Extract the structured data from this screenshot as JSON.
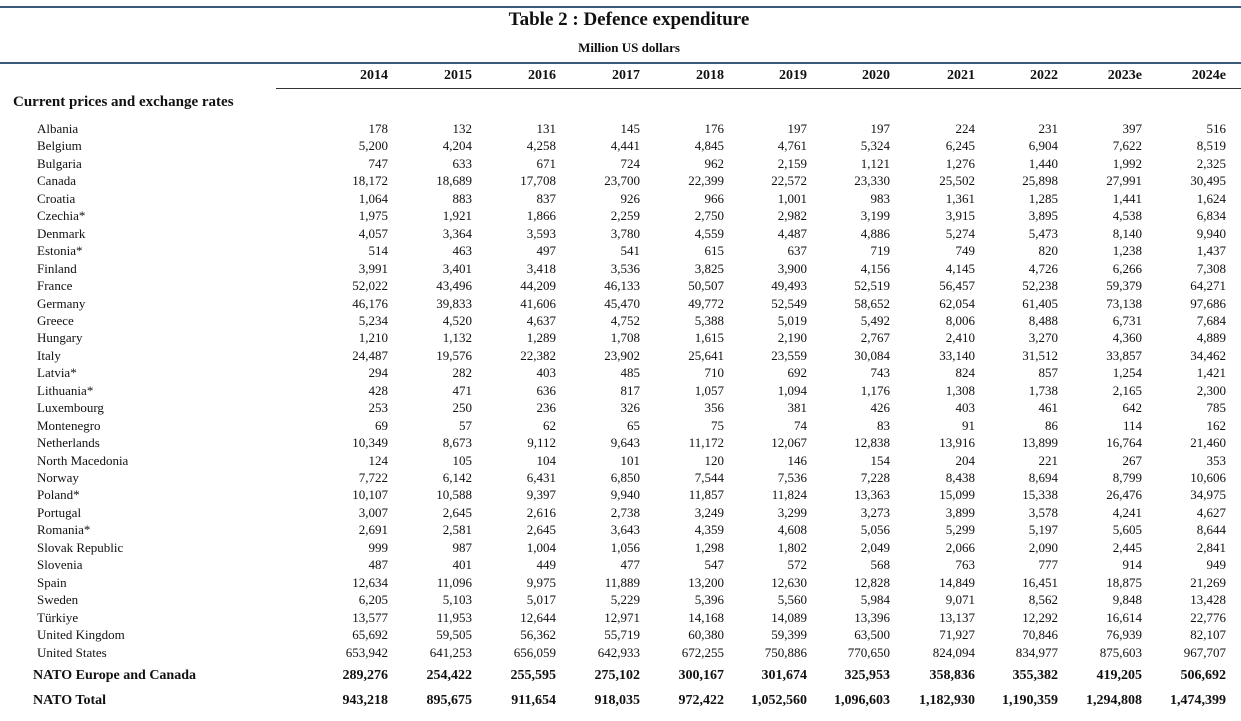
{
  "title": "Table 2 : Defence expenditure",
  "subtitle": "Million US dollars",
  "years": [
    "2014",
    "2015",
    "2016",
    "2017",
    "2018",
    "2019",
    "2020",
    "2021",
    "2022",
    "2023e",
    "2024e"
  ],
  "section_label": "Current prices and exchange rates",
  "rows": [
    {
      "name": "Albania",
      "values": [
        "178",
        "132",
        "131",
        "145",
        "176",
        "197",
        "197",
        "224",
        "231",
        "397",
        "516"
      ]
    },
    {
      "name": "Belgium",
      "values": [
        "5,200",
        "4,204",
        "4,258",
        "4,441",
        "4,845",
        "4,761",
        "5,324",
        "6,245",
        "6,904",
        "7,622",
        "8,519"
      ]
    },
    {
      "name": "Bulgaria",
      "values": [
        "747",
        "633",
        "671",
        "724",
        "962",
        "2,159",
        "1,121",
        "1,276",
        "1,440",
        "1,992",
        "2,325"
      ]
    },
    {
      "name": "Canada",
      "values": [
        "18,172",
        "18,689",
        "17,708",
        "23,700",
        "22,399",
        "22,572",
        "23,330",
        "25,502",
        "25,898",
        "27,991",
        "30,495"
      ]
    },
    {
      "name": "Croatia",
      "values": [
        "1,064",
        "883",
        "837",
        "926",
        "966",
        "1,001",
        "983",
        "1,361",
        "1,285",
        "1,441",
        "1,624"
      ]
    },
    {
      "name": "Czechia*",
      "values": [
        "1,975",
        "1,921",
        "1,866",
        "2,259",
        "2,750",
        "2,982",
        "3,199",
        "3,915",
        "3,895",
        "4,538",
        "6,834"
      ]
    },
    {
      "name": "Denmark",
      "values": [
        "4,057",
        "3,364",
        "3,593",
        "3,780",
        "4,559",
        "4,487",
        "4,886",
        "5,274",
        "5,473",
        "8,140",
        "9,940"
      ]
    },
    {
      "name": "Estonia*",
      "values": [
        "514",
        "463",
        "497",
        "541",
        "615",
        "637",
        "719",
        "749",
        "820",
        "1,238",
        "1,437"
      ]
    },
    {
      "name": "Finland",
      "values": [
        "3,991",
        "3,401",
        "3,418",
        "3,536",
        "3,825",
        "3,900",
        "4,156",
        "4,145",
        "4,726",
        "6,266",
        "7,308"
      ]
    },
    {
      "name": "France",
      "values": [
        "52,022",
        "43,496",
        "44,209",
        "46,133",
        "50,507",
        "49,493",
        "52,519",
        "56,457",
        "52,238",
        "59,379",
        "64,271"
      ]
    },
    {
      "name": "Germany",
      "values": [
        "46,176",
        "39,833",
        "41,606",
        "45,470",
        "49,772",
        "52,549",
        "58,652",
        "62,054",
        "61,405",
        "73,138",
        "97,686"
      ]
    },
    {
      "name": "Greece",
      "values": [
        "5,234",
        "4,520",
        "4,637",
        "4,752",
        "5,388",
        "5,019",
        "5,492",
        "8,006",
        "8,488",
        "6,731",
        "7,684"
      ]
    },
    {
      "name": "Hungary",
      "values": [
        "1,210",
        "1,132",
        "1,289",
        "1,708",
        "1,615",
        "2,190",
        "2,767",
        "2,410",
        "3,270",
        "4,360",
        "4,889"
      ]
    },
    {
      "name": "Italy",
      "values": [
        "24,487",
        "19,576",
        "22,382",
        "23,902",
        "25,641",
        "23,559",
        "30,084",
        "33,140",
        "31,512",
        "33,857",
        "34,462"
      ]
    },
    {
      "name": "Latvia*",
      "values": [
        "294",
        "282",
        "403",
        "485",
        "710",
        "692",
        "743",
        "824",
        "857",
        "1,254",
        "1,421"
      ]
    },
    {
      "name": "Lithuania*",
      "values": [
        "428",
        "471",
        "636",
        "817",
        "1,057",
        "1,094",
        "1,176",
        "1,308",
        "1,738",
        "2,165",
        "2,300"
      ]
    },
    {
      "name": "Luxembourg",
      "values": [
        "253",
        "250",
        "236",
        "326",
        "356",
        "381",
        "426",
        "403",
        "461",
        "642",
        "785"
      ]
    },
    {
      "name": "Montenegro",
      "values": [
        "69",
        "57",
        "62",
        "65",
        "75",
        "74",
        "83",
        "91",
        "86",
        "114",
        "162"
      ]
    },
    {
      "name": "Netherlands",
      "values": [
        "10,349",
        "8,673",
        "9,112",
        "9,643",
        "11,172",
        "12,067",
        "12,838",
        "13,916",
        "13,899",
        "16,764",
        "21,460"
      ]
    },
    {
      "name": "North Macedonia",
      "values": [
        "124",
        "105",
        "104",
        "101",
        "120",
        "146",
        "154",
        "204",
        "221",
        "267",
        "353"
      ]
    },
    {
      "name": "Norway",
      "values": [
        "7,722",
        "6,142",
        "6,431",
        "6,850",
        "7,544",
        "7,536",
        "7,228",
        "8,438",
        "8,694",
        "8,799",
        "10,606"
      ]
    },
    {
      "name": "Poland*",
      "values": [
        "10,107",
        "10,588",
        "9,397",
        "9,940",
        "11,857",
        "11,824",
        "13,363",
        "15,099",
        "15,338",
        "26,476",
        "34,975"
      ]
    },
    {
      "name": "Portugal",
      "values": [
        "3,007",
        "2,645",
        "2,616",
        "2,738",
        "3,249",
        "3,299",
        "3,273",
        "3,899",
        "3,578",
        "4,241",
        "4,627"
      ]
    },
    {
      "name": "Romania*",
      "values": [
        "2,691",
        "2,581",
        "2,645",
        "3,643",
        "4,359",
        "4,608",
        "5,056",
        "5,299",
        "5,197",
        "5,605",
        "8,644"
      ]
    },
    {
      "name": "Slovak Republic",
      "values": [
        "999",
        "987",
        "1,004",
        "1,056",
        "1,298",
        "1,802",
        "2,049",
        "2,066",
        "2,090",
        "2,445",
        "2,841"
      ]
    },
    {
      "name": "Slovenia",
      "values": [
        "487",
        "401",
        "449",
        "477",
        "547",
        "572",
        "568",
        "763",
        "777",
        "914",
        "949"
      ]
    },
    {
      "name": "Spain",
      "values": [
        "12,634",
        "11,096",
        "9,975",
        "11,889",
        "13,200",
        "12,630",
        "12,828",
        "14,849",
        "16,451",
        "18,875",
        "21,269"
      ]
    },
    {
      "name": "Sweden",
      "values": [
        "6,205",
        "5,103",
        "5,017",
        "5,229",
        "5,396",
        "5,560",
        "5,984",
        "9,071",
        "8,562",
        "9,848",
        "13,428"
      ]
    },
    {
      "name": "Türkiye",
      "values": [
        "13,577",
        "11,953",
        "12,644",
        "12,971",
        "14,168",
        "14,089",
        "13,396",
        "13,137",
        "12,292",
        "16,614",
        "22,776"
      ]
    },
    {
      "name": "United Kingdom",
      "values": [
        "65,692",
        "59,505",
        "56,362",
        "55,719",
        "60,380",
        "59,399",
        "63,500",
        "71,927",
        "70,846",
        "76,939",
        "82,107"
      ]
    },
    {
      "name": "United States",
      "values": [
        "653,942",
        "641,253",
        "656,059",
        "642,933",
        "672,255",
        "750,886",
        "770,650",
        "824,094",
        "834,977",
        "875,603",
        "967,707"
      ]
    }
  ],
  "totals": [
    {
      "name": "NATO Europe and Canada",
      "values": [
        "289,276",
        "254,422",
        "255,595",
        "275,102",
        "300,167",
        "301,674",
        "325,953",
        "358,836",
        "355,382",
        "419,205",
        "506,692"
      ]
    },
    {
      "name": "NATO Total",
      "values": [
        "943,218",
        "895,675",
        "911,654",
        "918,035",
        "972,422",
        "1,052,560",
        "1,096,603",
        "1,182,930",
        "1,190,359",
        "1,294,808",
        "1,474,399"
      ]
    }
  ]
}
